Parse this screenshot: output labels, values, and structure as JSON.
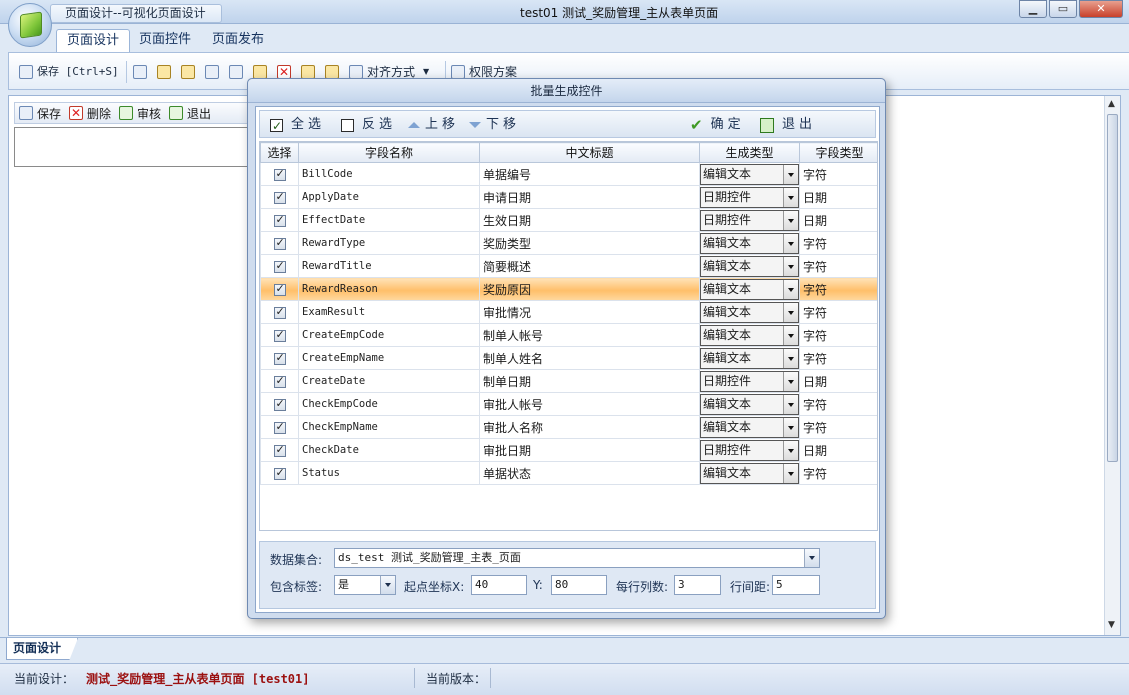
{
  "app": {
    "title": "页面设计--可视化页面设计",
    "window_title": "test01  测试_奖励管理_主从表单页面",
    "window_buttons": [
      "minimize",
      "maximize",
      "close"
    ]
  },
  "ribbon_tabs": [
    "页面设计",
    "页面控件",
    "页面发布"
  ],
  "ribbon_toolbar": {
    "save_label": "保存 [Ctrl+S]",
    "align_label": "对齐方式",
    "permission_label": "权限方案"
  },
  "inner_toolbar": {
    "save": "保存",
    "delete": "删除",
    "audit": "审核",
    "exit": "退出"
  },
  "dialog": {
    "title": "批量生成控件",
    "toolbar": {
      "select_all": "全选",
      "invert": "反选",
      "move_up": "上移",
      "move_down": "下移",
      "confirm": "确定",
      "exit": "退出"
    },
    "columns": [
      "选择",
      "字段名称",
      "中文标题",
      "生成类型",
      "字段类型"
    ],
    "rows": [
      {
        "checked": true,
        "field": "BillCode",
        "title": "单据编号",
        "gen": "编辑文本",
        "type": "字符"
      },
      {
        "checked": true,
        "field": "ApplyDate",
        "title": "申请日期",
        "gen": "日期控件",
        "type": "日期"
      },
      {
        "checked": true,
        "field": "EffectDate",
        "title": "生效日期",
        "gen": "日期控件",
        "type": "日期"
      },
      {
        "checked": true,
        "field": "RewardType",
        "title": "奖励类型",
        "gen": "编辑文本",
        "type": "字符"
      },
      {
        "checked": true,
        "field": "RewardTitle",
        "title": "简要概述",
        "gen": "编辑文本",
        "type": "字符"
      },
      {
        "checked": true,
        "field": "RewardReason",
        "title": "奖励原因",
        "gen": "编辑文本",
        "type": "字符",
        "selected": true
      },
      {
        "checked": true,
        "field": "ExamResult",
        "title": "审批情况",
        "gen": "编辑文本",
        "type": "字符"
      },
      {
        "checked": true,
        "field": "CreateEmpCode",
        "title": "制单人帐号",
        "gen": "编辑文本",
        "type": "字符"
      },
      {
        "checked": true,
        "field": "CreateEmpName",
        "title": "制单人姓名",
        "gen": "编辑文本",
        "type": "字符"
      },
      {
        "checked": true,
        "field": "CreateDate",
        "title": "制单日期",
        "gen": "日期控件",
        "type": "日期"
      },
      {
        "checked": true,
        "field": "CheckEmpCode",
        "title": "审批人帐号",
        "gen": "编辑文本",
        "type": "字符"
      },
      {
        "checked": true,
        "field": "CheckEmpName",
        "title": "审批人名称",
        "gen": "编辑文本",
        "type": "字符"
      },
      {
        "checked": true,
        "field": "CheckDate",
        "title": "审批日期",
        "gen": "日期控件",
        "type": "日期"
      },
      {
        "checked": true,
        "field": "Status",
        "title": "单据状态",
        "gen": "编辑文本",
        "type": "字符"
      }
    ],
    "footer": {
      "dataset_label": "数据集合:",
      "dataset_value": "ds_test  测试_奖励管理_主表_页面",
      "include_label_label": "包含标签:",
      "include_label_value": "是",
      "origin_x_label": "起点坐标X:",
      "origin_x_value": "40",
      "origin_y_label": "Y:",
      "origin_y_value": "80",
      "cols_per_row_label": "每行列数:",
      "cols_per_row_value": "3",
      "row_spacing_label": "行间距:",
      "row_spacing_value": "5"
    }
  },
  "bottom_tab": "页面设计",
  "status_bar": {
    "current_design_label": "当前设计：",
    "current_design_value": "测试_奖励管理_主从表单页面 [test01]",
    "current_version_label": "当前版本："
  }
}
